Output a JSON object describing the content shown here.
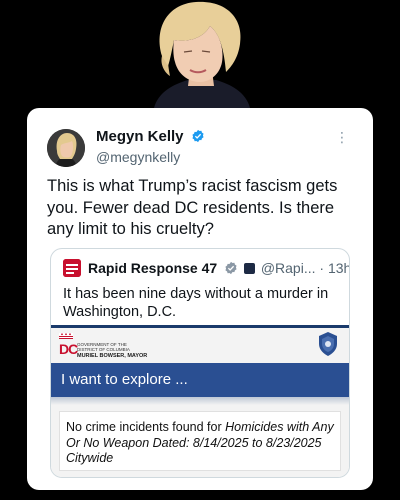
{
  "tweet": {
    "display_name": "Megyn Kelly",
    "handle": "@megynkelly",
    "text": "This is what Trump’s racist fascism gets you. Fewer dead DC residents. Is there any limit to his cruelty?",
    "more_glyph": "⋮"
  },
  "quote": {
    "display_name": "Rapid Response 47",
    "handle": "@Rapi...",
    "separator": "·",
    "time": "13h",
    "text": "It has been nine days without a murder in Washington, D.C."
  },
  "embed": {
    "dc_letters": "DC",
    "dc_govline_1": "GOVERNMENT OF THE",
    "dc_govline_2": "DISTRICT OF COLUMBIA",
    "dc_mayor": "MURIEL BOWSER, MAYOR",
    "explore_label": "I want to explore ...",
    "result_prefix": "No crime incidents found for ",
    "result_query": "Homicides with Any Or No Weapon Dated: 8/14/2025 to 8/23/2025 Citywide"
  },
  "colors": {
    "verified_blue": "#1d9bf0",
    "explore_blue": "#2a4f92",
    "dc_red": "#c8102e",
    "background": "#000000",
    "card": "#ffffff"
  },
  "icons": {
    "verified": "verified-badge-icon",
    "more": "more-options-icon",
    "gov_label": "government-label-icon",
    "police_badge": "police-badge-icon"
  }
}
